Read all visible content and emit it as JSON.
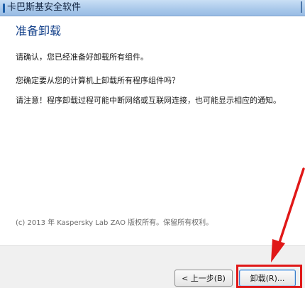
{
  "window": {
    "title": "卡巴斯基安全软件"
  },
  "main": {
    "heading": "准备卸载",
    "confirm_text": "请确认，您已经准备好卸载所有组件。",
    "question_text": "您确定要从您的计算机上卸载所有程序组件吗？",
    "warning_text": "请注意！程序卸载过程可能中断网络或互联网连接，也可能显示相应的通知。",
    "copyright": "(c) 2013 年 Kaspersky Lab ZAO 版权所有。保留所有权利。"
  },
  "footer": {
    "back_label": "< 上一步(B)",
    "uninstall_label": "卸载(R)..."
  },
  "annotation": {
    "color": "#e01818"
  },
  "colors": {
    "heading": "#15428b",
    "titlebar": "#a9c8ea"
  }
}
